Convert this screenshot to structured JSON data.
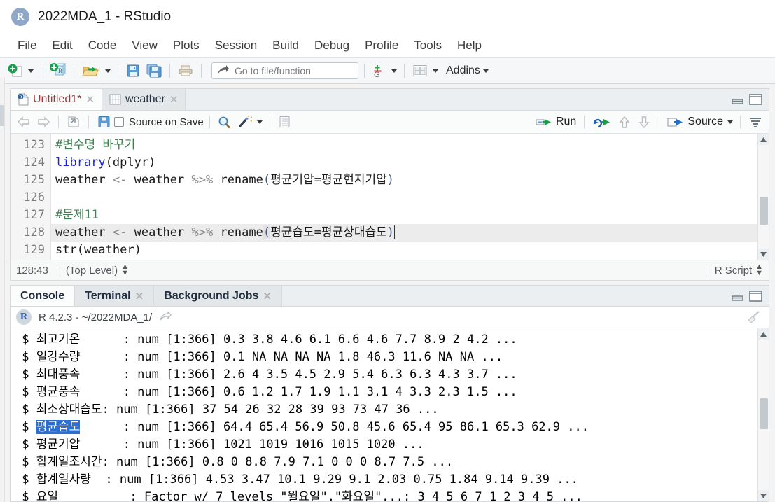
{
  "window": {
    "title": "2022MDA_1 - RStudio",
    "app_icon": "R",
    "icon_label": "rstudio-logo"
  },
  "menubar": {
    "items": [
      "File",
      "Edit",
      "Code",
      "View",
      "Plots",
      "Session",
      "Build",
      "Debug",
      "Profile",
      "Tools",
      "Help"
    ]
  },
  "toolbar": {
    "new_file_icon": "new-file-icon",
    "new_project_icon": "new-project-icon",
    "open_icon": "open-file-icon",
    "save_icon": "save-icon",
    "save_all_icon": "save-all-icon",
    "print_icon": "print-icon",
    "goto_placeholder": "Go to file/function",
    "goto_value": "",
    "goto_icon": "goto-arrow-icon",
    "git_icon": "version-control-icon",
    "panes_icon": "workspace-panes-icon",
    "addins_label": "Addins"
  },
  "source": {
    "tabs": [
      {
        "label": "Untitled1*",
        "icon": "r-script-icon",
        "active": true,
        "unsaved": true,
        "closable": true
      },
      {
        "label": "weather",
        "icon": "data-frame-icon",
        "active": false,
        "unsaved": false,
        "closable": true
      }
    ],
    "editor_toolbar": {
      "back_icon": "back-arrow-icon",
      "forward_icon": "forward-arrow-icon",
      "popout_icon": "show-in-new-window-icon",
      "save_icon": "save-icon",
      "source_on_save_label": "Source on Save",
      "source_on_save_checked": false,
      "find_icon": "find-replace-icon",
      "magic_icon": "code-tools-icon",
      "compile_report_icon": "compile-report-icon",
      "run_label": "Run",
      "rerun_icon": "re-run-icon",
      "prev_chunk_icon": "previous-chunk-icon",
      "next_chunk_icon": "next-chunk-icon",
      "source_label": "Source",
      "outline_icon": "document-outline-icon"
    },
    "line_numbers": [
      "123",
      "124",
      "125",
      "126",
      "127",
      "128",
      "129"
    ],
    "lines": [
      {
        "n": "123",
        "segments": [
          {
            "t": "#변수명 바꾸기",
            "c": "tok-comment"
          }
        ]
      },
      {
        "n": "124",
        "segments": [
          {
            "t": "library",
            "c": "tok-fn"
          },
          {
            "t": "(dplyr)",
            "c": ""
          }
        ]
      },
      {
        "n": "125",
        "segments": [
          {
            "t": "weather ",
            "c": ""
          },
          {
            "t": "<-",
            "c": "tok-op"
          },
          {
            "t": " weather ",
            "c": ""
          },
          {
            "t": "%>%",
            "c": "tok-op"
          },
          {
            "t": " rename",
            "c": ""
          },
          {
            "t": "(",
            "c": "tok-paren"
          },
          {
            "t": "평균기압=평균현지기압",
            "c": ""
          },
          {
            "t": ")",
            "c": "tok-paren"
          }
        ]
      },
      {
        "n": "126",
        "segments": []
      },
      {
        "n": "127",
        "segments": [
          {
            "t": "#문제11",
            "c": "tok-comment"
          }
        ]
      },
      {
        "n": "128",
        "segments": [
          {
            "t": "weather ",
            "c": ""
          },
          {
            "t": "<-",
            "c": "tok-op"
          },
          {
            "t": " weather ",
            "c": ""
          },
          {
            "t": "%>%",
            "c": "tok-op"
          },
          {
            "t": " rename",
            "c": ""
          },
          {
            "t": "(",
            "c": "tok-hl tok-paren"
          },
          {
            "t": "평균습도=평균상대습도",
            "c": ""
          },
          {
            "t": ")",
            "c": "tok-paren"
          }
        ],
        "current": true,
        "caret_at_end": true
      },
      {
        "n": "129",
        "segments": [
          {
            "t": "str",
            "c": ""
          },
          {
            "t": "(weather)",
            "c": ""
          }
        ]
      }
    ],
    "status": {
      "cursor_position": "128:43",
      "scope": "(Top Level)",
      "file_type": "R Script"
    }
  },
  "console": {
    "tabs": [
      {
        "label": "Console",
        "active": true,
        "closable": false
      },
      {
        "label": "Terminal",
        "active": false,
        "closable": true
      },
      {
        "label": "Background Jobs",
        "active": false,
        "closable": true
      }
    ],
    "panel_controls": {
      "minimize_icon": "minimize-panel-icon",
      "maximize_icon": "maximize-panel-icon"
    },
    "header": {
      "r_badge": "R",
      "version_and_path": "R 4.2.3 · ~/2022MDA_1/",
      "popout_icon": "show-in-new-window-icon",
      "clear_icon": "clear-console-broom-icon"
    },
    "output_lines": [
      {
        "prefix": " $ ",
        "name": "최고기온",
        "name_pad": "      ",
        "rest": ": num [1:366] 0.3 3.8 4.6 6.1 6.6 4.6 7.7 8.9 2 4.2 ...",
        "selected": false
      },
      {
        "prefix": " $ ",
        "name": "일강수량",
        "name_pad": "      ",
        "rest": ": num [1:366] 0.1 NA NA NA NA 1.8 46.3 11.6 NA NA ...",
        "selected": false
      },
      {
        "prefix": " $ ",
        "name": "최대풍속",
        "name_pad": "      ",
        "rest": ": num [1:366] 2.6 4 3.5 4.5 2.9 5.4 6.3 6.3 4.3 3.7 ...",
        "selected": false
      },
      {
        "prefix": " $ ",
        "name": "평균풍속",
        "name_pad": "      ",
        "rest": ": num [1:366] 0.6 1.2 1.7 1.9 1.1 3.1 4 3.3 2.3 1.5 ...",
        "selected": false
      },
      {
        "prefix": " $ ",
        "name": "최소상대습도",
        "name_pad": "",
        "rest": ": num [1:366] 37 54 26 32 28 39 93 73 47 36 ...",
        "selected": false
      },
      {
        "prefix": " $ ",
        "name": "평균습도",
        "name_pad": "      ",
        "rest": ": num [1:366] 64.4 65.4 56.9 50.8 45.6 65.4 95 86.1 65.3 62.9 ...",
        "selected": true
      },
      {
        "prefix": " $ ",
        "name": "평균기압",
        "name_pad": "      ",
        "rest": ": num [1:366] 1021 1019 1016 1015 1020 ...",
        "selected": false
      },
      {
        "prefix": " $ ",
        "name": "합계일조시간",
        "name_pad": "",
        "rest": ": num [1:366] 0.8 0 8.8 7.9 7.1 0 0 0 8.7 7.5 ...",
        "selected": false
      },
      {
        "prefix": " $ ",
        "name": "합계일사량",
        "name_pad": "  ",
        "rest": ": num [1:366] 4.53 3.47 10.1 9.29 9.1 2.03 0.75 1.84 9.14 9.39 ...",
        "selected": false
      },
      {
        "prefix": " $ ",
        "name": "요일",
        "name_pad": "          ",
        "rest": ": Factor w/ 7 levels \"월요일\",\"화요일\"...: 3 4 5 6 7 1 2 3 4 5 ...",
        "selected": false
      }
    ]
  },
  "colors": {
    "accent_blue": "#2a6fd6",
    "comment_green": "#3f8050",
    "function_blue": "#1b21d4",
    "unsaved_red": "#9c3a3a",
    "toolbar_bg": "#f5f7f8",
    "panel_border": "#d6dadd"
  }
}
